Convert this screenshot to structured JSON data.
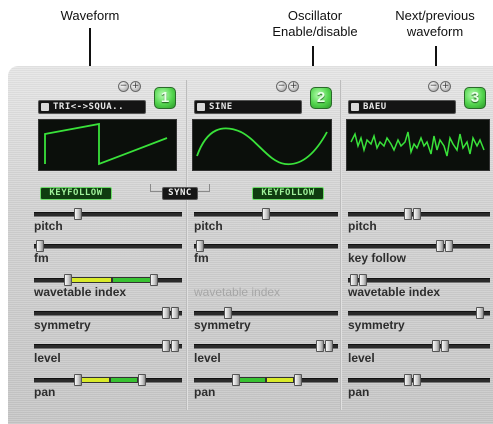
{
  "callouts": {
    "waveform": "Waveform",
    "osc_line1": "Oscillator",
    "osc_line2": "Enable/disable",
    "next_line1": "Next/previous",
    "next_line2": "waveform"
  },
  "oscillators": [
    {
      "number": "1",
      "waveform_name": "TRI<->SQUA..",
      "waveform_shape": "square-saw",
      "keyfollow_label": "KEYFOLLOW",
      "params": [
        "pitch",
        "fm",
        "wavetable index",
        "symmetry",
        "level",
        "pan"
      ]
    },
    {
      "number": "2",
      "waveform_name": "SINE",
      "waveform_shape": "sine",
      "sync_label": "SYNC",
      "keyfollow_label": "KEYFOLLOW",
      "params": [
        "pitch",
        "fm",
        "wavetable index",
        "symmetry",
        "level",
        "pan"
      ]
    },
    {
      "number": "3",
      "waveform_name": "BAEU",
      "waveform_shape": "noise",
      "params": [
        "pitch",
        "key follow",
        "wavetable index",
        "symmetry",
        "level",
        "pan"
      ]
    }
  ],
  "colors": {
    "accent_green": "#52d44d",
    "trace_green": "#39e23a",
    "range_yellow": "#d9ea2a"
  }
}
